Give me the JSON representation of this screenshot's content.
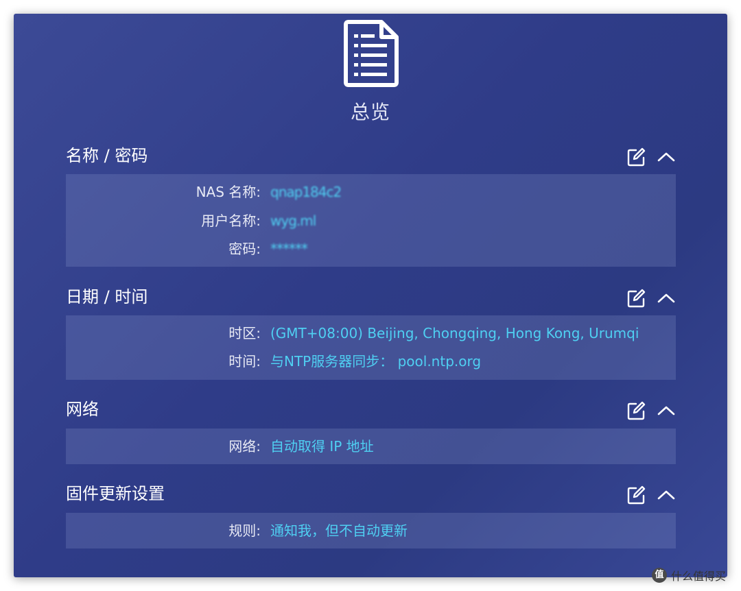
{
  "header": {
    "icon": "document-list-icon",
    "title": "总览"
  },
  "sections": [
    {
      "title": "名称 / 密码",
      "rows": [
        {
          "label": "NAS 名称:",
          "value": "qnap184c2"
        },
        {
          "label": "用户名称:",
          "value": "wyg.ml"
        },
        {
          "label": "密码:",
          "value": "******"
        }
      ]
    },
    {
      "title": "日期 / 时间",
      "rows": [
        {
          "label": "时区:",
          "value": "(GMT+08:00) Beijing, Chongqing, Hong Kong, Urumqi"
        },
        {
          "label": "时间:",
          "value": "与NTP服务器同步：  pool.ntp.org"
        }
      ]
    },
    {
      "title": "网络",
      "rows": [
        {
          "label": "网络:",
          "value": "自动取得 IP 地址"
        }
      ]
    },
    {
      "title": "固件更新设置",
      "rows": [
        {
          "label": "规则:",
          "value": "通知我，但不自动更新"
        }
      ]
    }
  ],
  "icons": {
    "edit": "edit-icon",
    "collapse": "chevron-up-icon"
  },
  "colors": {
    "background": "#2f3c88",
    "value_text": "#4fd0f2",
    "label_text": "#e8eaf5"
  },
  "watermark": {
    "logo": "值",
    "text": "什么值得买"
  }
}
